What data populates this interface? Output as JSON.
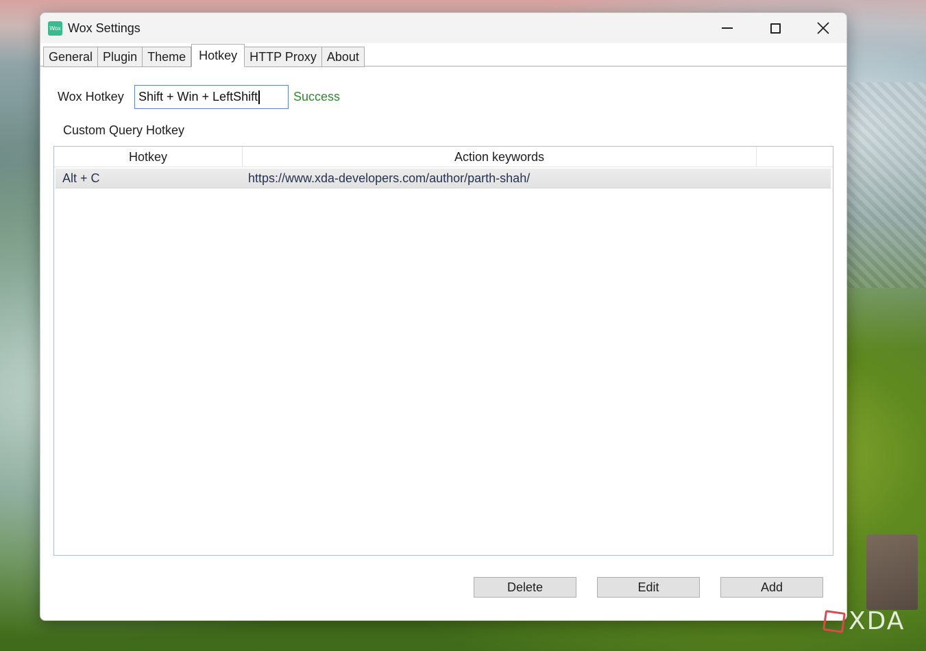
{
  "window": {
    "title": "Wox Settings",
    "icon_text": "Wox"
  },
  "tabs": [
    {
      "label": "General",
      "active": false
    },
    {
      "label": "Plugin",
      "active": false
    },
    {
      "label": "Theme",
      "active": false
    },
    {
      "label": "Hotkey",
      "active": true
    },
    {
      "label": "HTTP Proxy",
      "active": false
    },
    {
      "label": "About",
      "active": false
    }
  ],
  "hotkey": {
    "label": "Wox Hotkey",
    "value": "Shift + Win + LeftShift",
    "status": "Success"
  },
  "custom_query": {
    "label": "Custom Query Hotkey",
    "columns": [
      "Hotkey",
      "Action keywords",
      ""
    ],
    "rows": [
      {
        "hotkey": "Alt + C",
        "action": "https://www.xda-developers.com/author/parth-shah/"
      }
    ]
  },
  "buttons": {
    "delete": "Delete",
    "edit": "Edit",
    "add": "Add"
  },
  "watermark": "XDA"
}
